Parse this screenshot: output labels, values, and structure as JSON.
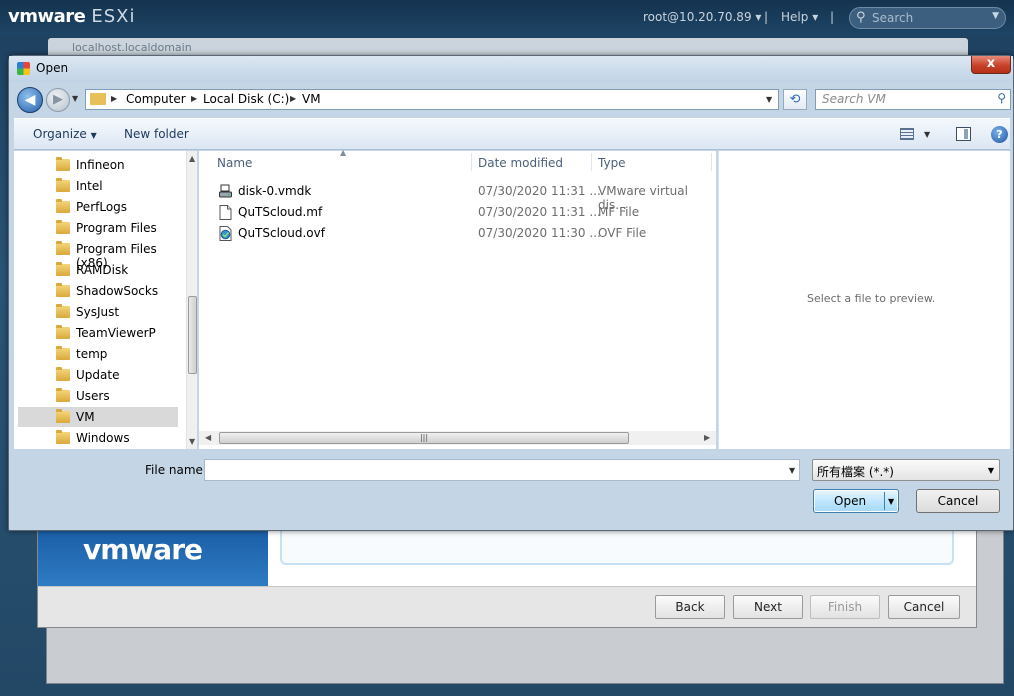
{
  "esxi": {
    "brand": "vmware",
    "product": "ESXi",
    "user": "root@10.20.70.89",
    "user_caret": "▾",
    "separator": "|",
    "help": "Help",
    "help_caret": "▾",
    "search_placeholder": "Search"
  },
  "background": {
    "tab_label": "localhost.localdomain"
  },
  "wizard": {
    "brand": "vmware",
    "buttons": {
      "back": "Back",
      "next": "Next",
      "finish": "Finish",
      "cancel": "Cancel"
    }
  },
  "dialog": {
    "title": "Open",
    "close": "x",
    "breadcrumb": [
      "Computer",
      "Local Disk (C:)",
      "VM"
    ],
    "search_placeholder": "Search VM",
    "toolbar": {
      "organize": "Organize",
      "new_folder": "New folder"
    },
    "tree": [
      {
        "label": "Infineon"
      },
      {
        "label": "Intel"
      },
      {
        "label": "PerfLogs"
      },
      {
        "label": "Program Files"
      },
      {
        "label": "Program Files (x86)"
      },
      {
        "label": "RAMDisk"
      },
      {
        "label": "ShadowSocks"
      },
      {
        "label": "SysJust"
      },
      {
        "label": "TeamViewerP"
      },
      {
        "label": "temp"
      },
      {
        "label": "Update"
      },
      {
        "label": "Users"
      },
      {
        "label": "VM",
        "selected": true
      },
      {
        "label": "Windows"
      }
    ],
    "columns": {
      "name": "Name",
      "date": "Date modified",
      "type": "Type"
    },
    "files": [
      {
        "name": "disk-0.vmdk",
        "date": "07/30/2020 11:31 ...",
        "type": "VMware virtual dis...",
        "icon": "disk-icon"
      },
      {
        "name": "QuTScloud.mf",
        "date": "07/30/2020 11:31 ...",
        "type": "MF File",
        "icon": "document-icon"
      },
      {
        "name": "QuTScloud.ovf",
        "date": "07/30/2020 11:30 ...",
        "type": "OVF File",
        "icon": "ovf-file-icon"
      }
    ],
    "preview_text": "Select a file to preview.",
    "file_name_label": "File name:",
    "file_name_value": "",
    "file_type": "所有檔案 (*.*)",
    "open": "Open",
    "cancel": "Cancel"
  },
  "colors": {
    "esxi_header": "#1e4566",
    "dialog_frame": "#c4d5e6",
    "open_button": "#bee6fd",
    "close_button": "#c8412a"
  }
}
